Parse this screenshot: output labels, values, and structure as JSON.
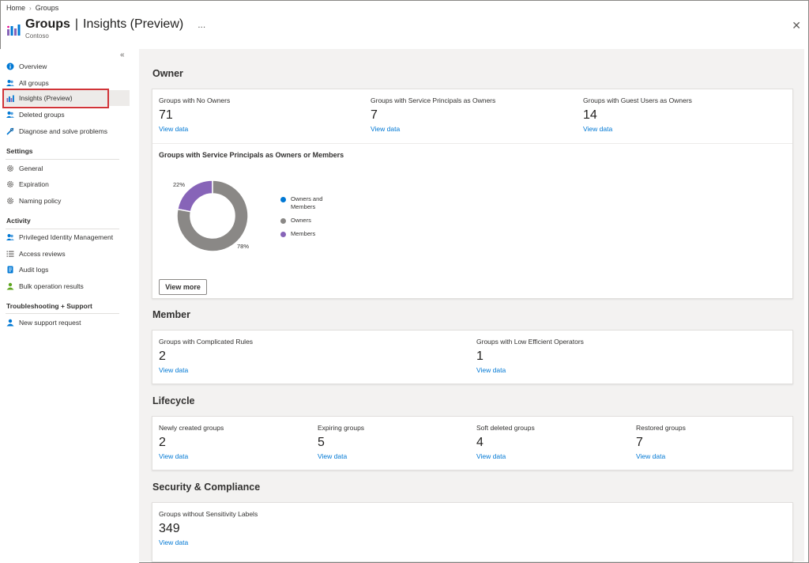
{
  "breadcrumb": [
    "Home",
    "Groups"
  ],
  "header": {
    "title": "Groups",
    "separator": "|",
    "subtitle": "Insights (Preview)",
    "more": "...",
    "tenant": "Contoso",
    "close": "✕"
  },
  "sidebar": {
    "collapse": "«",
    "items": [
      {
        "label": "Overview",
        "icon": "info-icon"
      },
      {
        "label": "All groups",
        "icon": "people-icon"
      },
      {
        "label": "Insights (Preview)",
        "icon": "chart-icon",
        "active": true
      },
      {
        "label": "Deleted groups",
        "icon": "people-icon"
      },
      {
        "label": "Diagnose and solve problems",
        "icon": "wrench-icon"
      }
    ],
    "settings_title": "Settings",
    "settings": [
      {
        "label": "General",
        "icon": "gear-icon"
      },
      {
        "label": "Expiration",
        "icon": "gear-icon"
      },
      {
        "label": "Naming policy",
        "icon": "gear-icon"
      }
    ],
    "activity_title": "Activity",
    "activity": [
      {
        "label": "Privileged Identity Management",
        "icon": "people-icon"
      },
      {
        "label": "Access reviews",
        "icon": "list-icon"
      },
      {
        "label": "Audit logs",
        "icon": "log-icon"
      },
      {
        "label": "Bulk operation results",
        "icon": "bulk-icon"
      }
    ],
    "support_title": "Troubleshooting + Support",
    "support": [
      {
        "label": "New support request",
        "icon": "support-icon"
      }
    ]
  },
  "owner": {
    "title": "Owner",
    "metrics": [
      {
        "label": "Groups with No Owners",
        "value": "71",
        "link": "View data"
      },
      {
        "label": "Groups with Service Principals as Owners",
        "value": "7",
        "link": "View data"
      },
      {
        "label": "Groups with Guest Users as Owners",
        "value": "14",
        "link": "View data"
      }
    ],
    "chart_title": "Groups with Service Principals as Owners or Members",
    "view_more": "View more"
  },
  "chart_data": {
    "type": "pie",
    "title": "Groups with Service Principals as Owners or Members",
    "series": [
      {
        "name": "Owners and Members",
        "value": 0,
        "label": "",
        "color": "#0078d4"
      },
      {
        "name": "Owners",
        "value": 78,
        "label": "78%",
        "color": "#8a8886"
      },
      {
        "name": "Members",
        "value": 22,
        "label": "22%",
        "color": "#8764b8"
      }
    ],
    "legend_placement": "right"
  },
  "member": {
    "title": "Member",
    "metrics": [
      {
        "label": "Groups with Complicated Rules",
        "value": "2",
        "link": "View data"
      },
      {
        "label": "Groups with Low Efficient Operators",
        "value": "1",
        "link": "View data"
      }
    ]
  },
  "lifecycle": {
    "title": "Lifecycle",
    "metrics": [
      {
        "label": "Newly created groups",
        "value": "2",
        "link": "View data"
      },
      {
        "label": "Expiring groups",
        "value": "5",
        "link": "View data"
      },
      {
        "label": "Soft deleted groups",
        "value": "4",
        "link": "View data"
      },
      {
        "label": "Restored groups",
        "value": "7",
        "link": "View data"
      }
    ]
  },
  "security": {
    "title": "Security & Compliance",
    "metrics": [
      {
        "label": "Groups without Sensitivity Labels",
        "value": "349",
        "link": "View data"
      }
    ]
  }
}
